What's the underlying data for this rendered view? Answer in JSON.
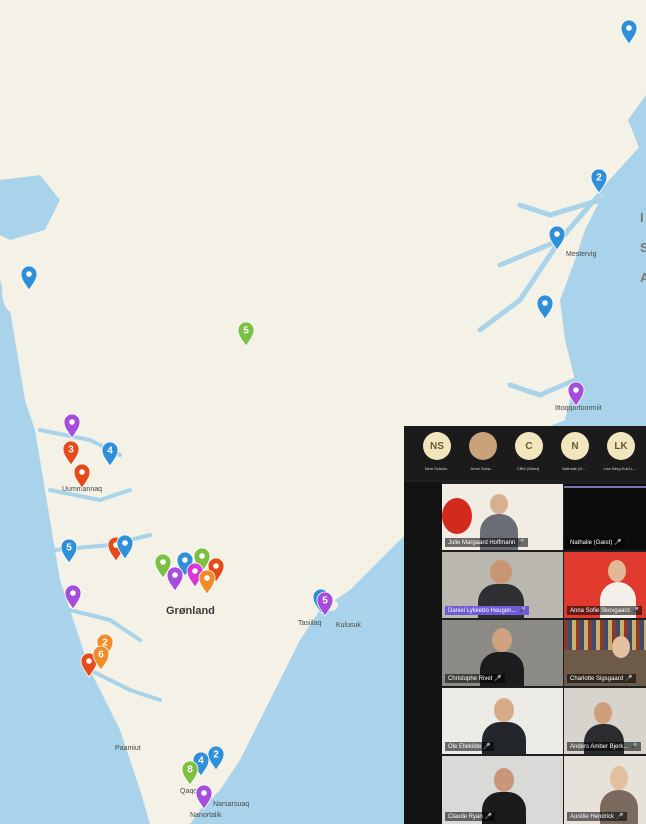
{
  "map": {
    "country_label": "Grønland",
    "edge_letter_1": "I",
    "edge_letter_2": "S",
    "edge_letter_3": "A",
    "places": {
      "mesterviq": "Mestervig",
      "ittoqqortoormiit": "Ittoqqortoormiit",
      "uummannaq": "Uummannaq",
      "tasiilaq": "Tasiilaq",
      "kulusuk": "Kulusuk",
      "paamiut": "Paamiut",
      "qaqortoq": "Qaqortoq",
      "narsarsuaq": "Narsarsuaq",
      "nanortalik": "Nanortalik"
    },
    "pins": [
      {
        "color": "#2f8fd8",
        "number": ""
      },
      {
        "color": "#2f8fd8",
        "number": "2"
      },
      {
        "color": "#2f8fd8",
        "number": ""
      },
      {
        "color": "#2f8fd8",
        "number": ""
      },
      {
        "color": "#a64ddb",
        "number": ""
      },
      {
        "color": "#2f8fd8",
        "number": ""
      },
      {
        "color": "#7bc043",
        "number": "5"
      },
      {
        "color": "#a64ddb",
        "number": ""
      },
      {
        "color": "#e64a19",
        "number": "3"
      },
      {
        "color": "#2f8fd8",
        "number": "4"
      },
      {
        "color": "#e64a19",
        "number": ""
      },
      {
        "color": "#2f8fd8",
        "number": "5"
      },
      {
        "color": "#e64a19",
        "number": ""
      },
      {
        "color": "#2f8fd8",
        "number": ""
      },
      {
        "color": "#a64ddb",
        "number": ""
      },
      {
        "color": "#7bc043",
        "number": ""
      },
      {
        "color": "#2f8fd8",
        "number": ""
      },
      {
        "color": "#7bc043",
        "number": ""
      },
      {
        "color": "#a64ddb",
        "number": ""
      },
      {
        "color": "#d63ad6",
        "number": ""
      },
      {
        "color": "#e64a19",
        "number": ""
      },
      {
        "color": "#f28c28",
        "number": ""
      },
      {
        "color": "#2f8fd8",
        "number": ""
      },
      {
        "color": "#a64ddb",
        "number": "5"
      },
      {
        "color": "#f28c28",
        "number": "2"
      },
      {
        "color": "#e64a19",
        "number": ""
      },
      {
        "color": "#f28c28",
        "number": "6"
      },
      {
        "color": "#2f8fd8",
        "number": "2"
      },
      {
        "color": "#2f8fd8",
        "number": "4"
      },
      {
        "color": "#7bc043",
        "number": "8"
      },
      {
        "color": "#a64ddb",
        "number": ""
      }
    ]
  },
  "call": {
    "top_participants": [
      {
        "initials": "NS",
        "name": "Nina Schultz"
      },
      {
        "initials": "",
        "name": "Anne Scha..."
      },
      {
        "initials": "C",
        "name": "CBM (Gæst)"
      },
      {
        "initials": "N",
        "name": "Nathalie (G..."
      },
      {
        "initials": "LK",
        "name": "Lise Berg Kold L..."
      }
    ],
    "tiles": [
      {
        "name": "Julie Margaard Hoffmann"
      },
      {
        "name": "Nathalie (Gæst)"
      },
      {
        "name": "Daniel Lykkebo Haugen..."
      },
      {
        "name": "Anna Sofie Skovgaard"
      },
      {
        "name": "Christophe Rivet"
      },
      {
        "name": "Charlotte Sigsgaard"
      },
      {
        "name": "Ole Ellekilde"
      },
      {
        "name": "Anders Amber Bjerk..."
      },
      {
        "name": "Claude Ryan"
      },
      {
        "name": "Aurélie Hendrick"
      }
    ]
  }
}
